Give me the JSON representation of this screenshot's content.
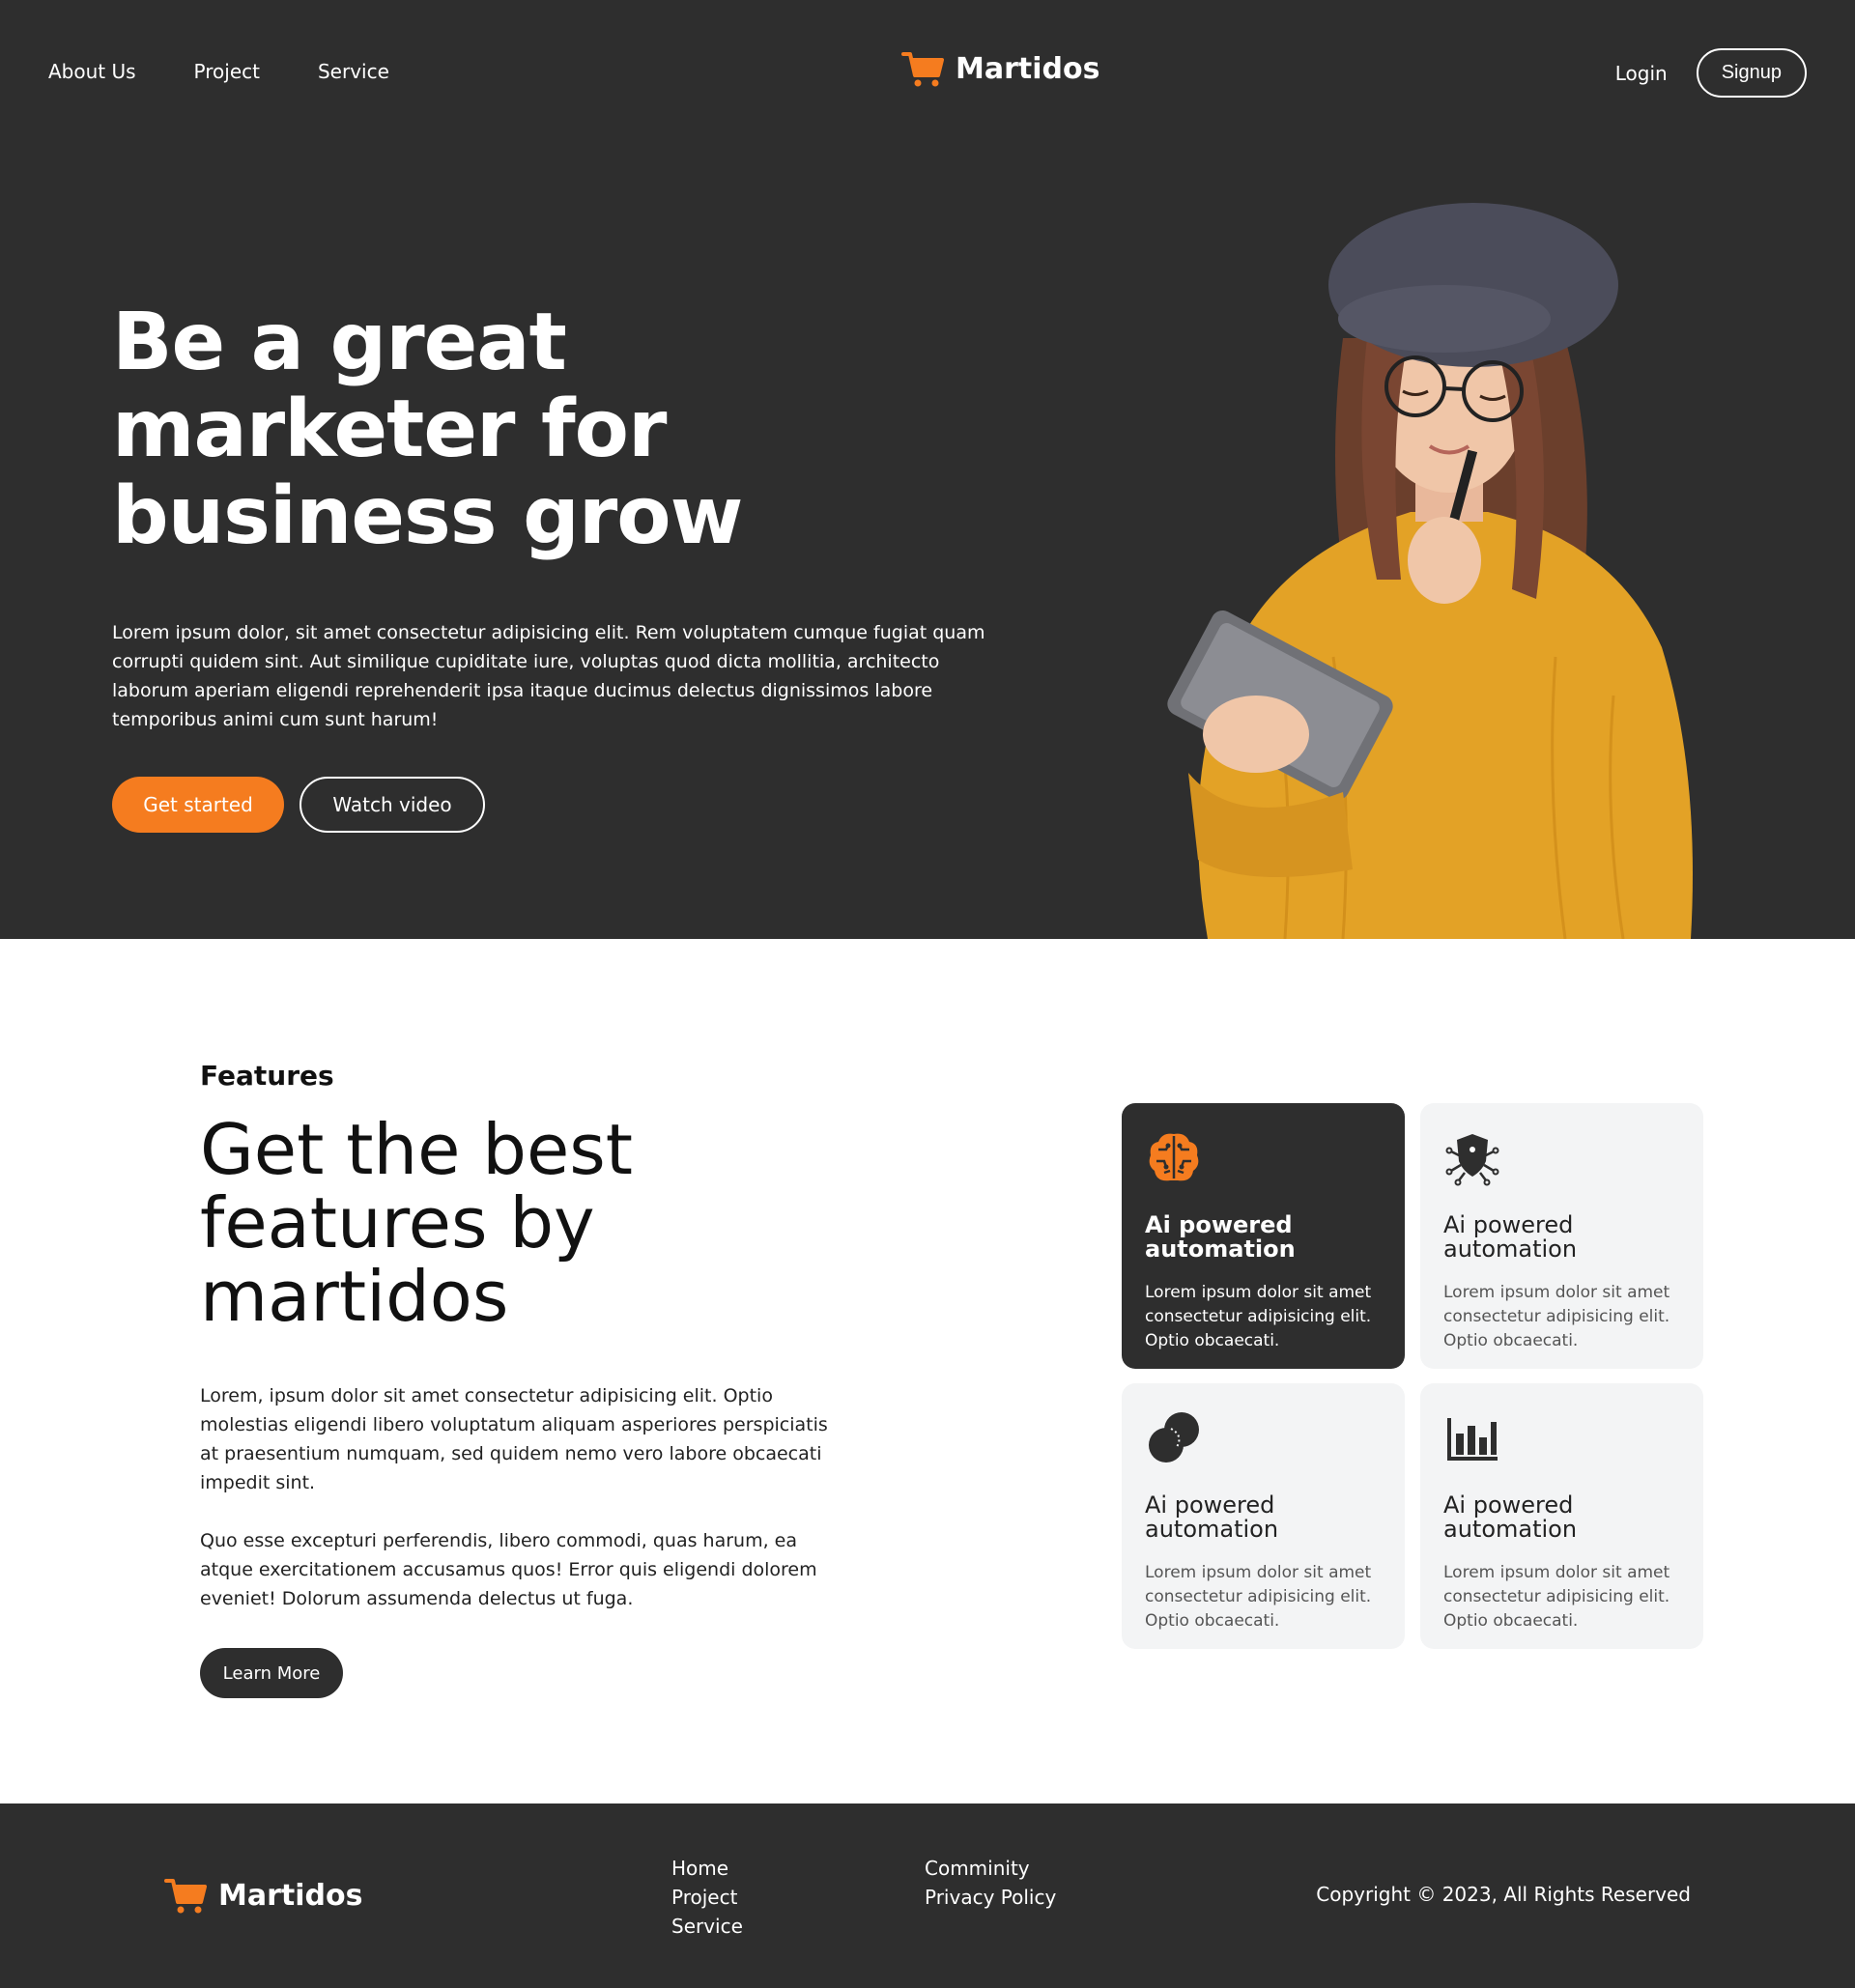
{
  "brand": {
    "name": "Martidos",
    "accent": "#f57c1f",
    "dark_bg": "#2e2e2e"
  },
  "nav": {
    "links": [
      "About Us",
      "Project",
      "Service"
    ],
    "login": "Login",
    "signup": "Signup"
  },
  "hero": {
    "title": "Be a great marketer for business grow",
    "body": "Lorem ipsum dolor, sit amet consectetur adipisicing elit. Rem voluptatem cumque fugiat quam corrupti quidem sint. Aut similique cupiditate iure, voluptas quod dicta mollitia, architecto laborum aperiam eligendi reprehenderit ipsa itaque ducimus delectus dignissimos labore temporibus animi cum sunt harum!",
    "primary_cta": "Get started",
    "secondary_cta": "Watch video"
  },
  "features": {
    "eyebrow": "Features",
    "title": "Get the best features by martidos",
    "paragraphs": [
      "Lorem, ipsum dolor sit amet consectetur adipisicing elit. Optio molestias eligendi libero voluptatum aliquam asperiores perspiciatis at praesentium numquam, sed quidem nemo vero labore obcaecati impedit sint.",
      "Quo esse excepturi perferendis, libero commodi, quas harum, ea atque exercitationem accusamus quos! Error quis eligendi dolorem eveniet! Dolorum assumenda delectus ut fuga."
    ],
    "cta": "Learn More",
    "cards": [
      {
        "icon": "brain-circuit-icon",
        "title": "Ai powered automation",
        "text": "Lorem ipsum dolor sit amet consectetur adipisicing elit. Optio obcaecati.",
        "active": true
      },
      {
        "icon": "shield-network-icon",
        "title": "Ai powered automation",
        "text": "Lorem ipsum dolor sit amet consectetur adipisicing elit. Optio obcaecati.",
        "active": false
      },
      {
        "icon": "overlapping-circles-icon",
        "title": "Ai powered automation",
        "text": "Lorem ipsum dolor sit amet consectetur adipisicing elit. Optio obcaecati.",
        "active": false
      },
      {
        "icon": "bar-chart-icon",
        "title": "Ai powered automation",
        "text": "Lorem ipsum dolor sit amet consectetur adipisicing elit. Optio obcaecati.",
        "active": false
      }
    ]
  },
  "footer": {
    "brand": "Martidos",
    "col1": [
      "Home",
      "Project",
      "Service"
    ],
    "col2": [
      "Comminity",
      "Privacy Policy"
    ],
    "copyright": "Copyright © 2023, All Rights Reserved"
  }
}
